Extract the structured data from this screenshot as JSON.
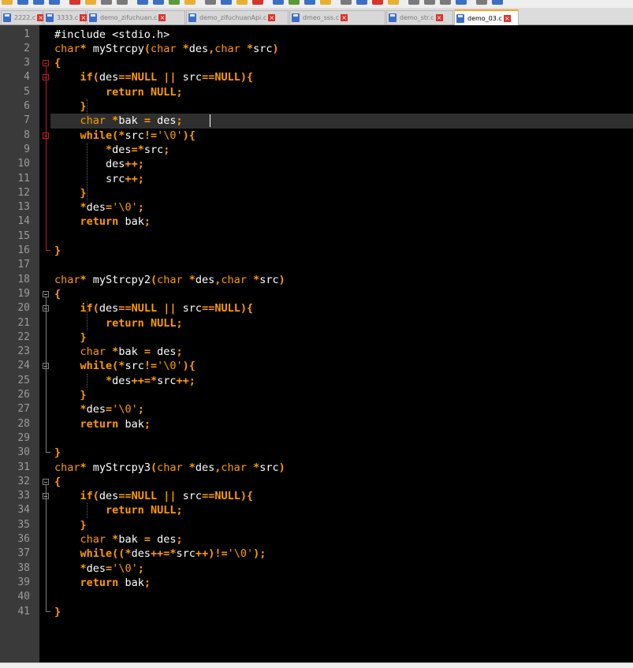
{
  "tabs": [
    {
      "label": "2222.c",
      "active": false
    },
    {
      "label": "3333.c",
      "active": false
    },
    {
      "label": "demo_zifuchuan.c",
      "active": false
    },
    {
      "label": "demo_zifuchuanApi.c",
      "active": false
    },
    {
      "label": "dmeo_sss.c",
      "active": false
    },
    {
      "label": "demo_str.c",
      "active": false
    },
    {
      "label": "demo_03.c",
      "active": true
    }
  ],
  "line_numbers": [
    "1",
    "2",
    "3",
    "4",
    "5",
    "6",
    "7",
    "8",
    "9",
    "10",
    "11",
    "12",
    "13",
    "14",
    "15",
    "16",
    "17",
    "18",
    "19",
    "20",
    "21",
    "22",
    "23",
    "24",
    "25",
    "26",
    "27",
    "28",
    "29",
    "30",
    "31",
    "32",
    "33",
    "34",
    "35",
    "36",
    "37",
    "38",
    "39",
    "40",
    "41"
  ],
  "code_lines": [
    "#include <stdio.h>",
    "char* myStrcpy(char *des,char *src)",
    "{",
    "    if(des==NULL || src==NULL){",
    "        return NULL;",
    "    }",
    "    char *bak = des;",
    "    while(*src!='\\0'){",
    "        *des=*src;",
    "        des++;",
    "        src++;",
    "    }",
    "    *des='\\0';",
    "    return bak;",
    "",
    "}",
    "",
    "char* myStrcpy2(char *des,char *src)",
    "{",
    "    if(des==NULL || src==NULL){",
    "        return NULL;",
    "    }",
    "    char *bak = des;",
    "    while(*src!='\\0'){",
    "        *des++=*src++;",
    "    }",
    "    *des='\\0';",
    "    return bak;",
    "",
    "}",
    "char* myStrcpy3(char *des,char *src)",
    "{",
    "    if(des==NULL || src==NULL){",
    "        return NULL;",
    "    }",
    "    char *bak = des;",
    "    while((*des++=*src++)!='\\0');",
    "    *des='\\0';",
    "    return bak;",
    "",
    "}"
  ],
  "current_line": 7,
  "colors": {
    "editor_bg": "#000000",
    "keyword": "#ff9b00",
    "text": "#ffffff",
    "gutter_bg": "#3a3a3a",
    "line_number": "#9b9b9b",
    "fold_active": "#c02020"
  }
}
